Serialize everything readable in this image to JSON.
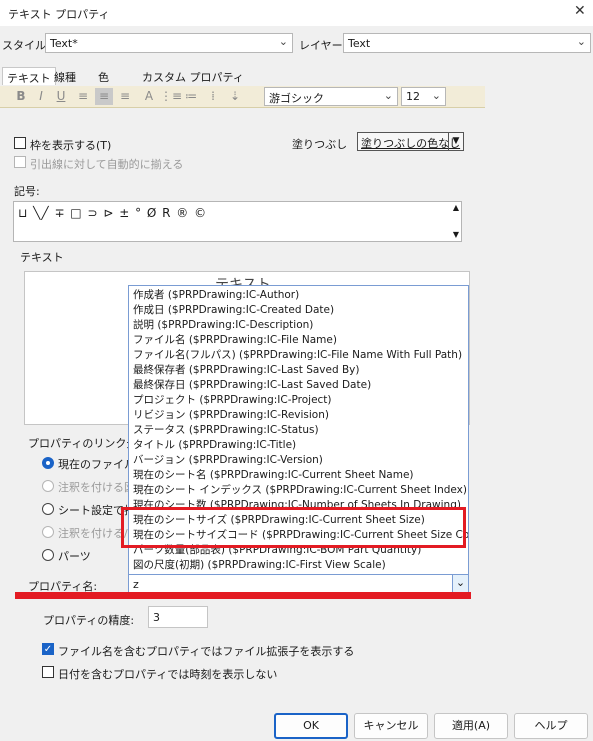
{
  "window": {
    "title": "テキスト プロパティ",
    "close_glyph": "✕"
  },
  "style": {
    "label": "スタイル:",
    "value": "Text*"
  },
  "layer": {
    "label": "レイヤー:",
    "value": "Text"
  },
  "tabs": [
    "テキスト",
    "線種",
    "色",
    "カスタム プロパティ"
  ],
  "toolbar": {
    "buttons": [
      {
        "glyph": "B",
        "icon": "bold-icon"
      },
      {
        "glyph": "I",
        "icon": "italic-icon"
      },
      {
        "glyph": "U",
        "icon": "underline-icon"
      },
      {
        "glyph": "≡",
        "icon": "align-left-icon"
      },
      {
        "glyph": "≡",
        "icon": "align-center-icon"
      },
      {
        "glyph": "≡",
        "icon": "align-right-icon"
      },
      {
        "glyph": "A",
        "icon": "stack-text-icon"
      },
      {
        "glyph": "⋮≡",
        "icon": "bullet-list-icon"
      },
      {
        "glyph": "≔",
        "icon": "numbered-list-icon"
      },
      {
        "glyph": "⁞",
        "icon": "list-icon"
      },
      {
        "glyph": "⇣",
        "icon": "insert-field-icon"
      }
    ],
    "font": "游ゴシック",
    "size": "12"
  },
  "frame": {
    "label": "枠を表示する(T)",
    "checked": false
  },
  "leader": {
    "label": "引出線に対して自動的に揃える",
    "checked": false,
    "disabled": true
  },
  "fill": {
    "label": "塗りつぶし",
    "value": "塗りつぶしの色なし"
  },
  "symbols": {
    "label": "記号:",
    "chars": "⊔ ╲╱ ∓ □ ⊃ ⊳ ± ° Ø R ® ©"
  },
  "text_group": {
    "label": "テキスト",
    "editor_text": "テキスト"
  },
  "link": {
    "label": "プロパティのリンク元を指",
    "options": [
      {
        "label": "現在のファイル",
        "selected": true,
        "disabled": false
      },
      {
        "label": "注釈を付ける図",
        "selected": false,
        "disabled": true
      },
      {
        "label": "シート設定で指",
        "selected": false,
        "disabled": false
      },
      {
        "label": "注釈を付ける/",
        "selected": false,
        "disabled": true
      },
      {
        "label": "パーツ",
        "selected": false,
        "disabled": false
      }
    ]
  },
  "property_name": {
    "label": "プロパティ名:",
    "value": "z"
  },
  "precision": {
    "label": "プロパティの精度:",
    "value": "3"
  },
  "show_ext": {
    "label": "ファイル名を含むプロパティではファイル拡張子を表示する",
    "checked": true
  },
  "hide_time": {
    "label": "日付を含むプロパティでは時刻を表示しない",
    "checked": false
  },
  "buttons": {
    "ok": "OK",
    "cancel": "キャンセル",
    "apply": "適用(A)",
    "help": "ヘルプ"
  },
  "dropdown": {
    "items": [
      "作成者  ($PRPDrawing:IC-Author)",
      "作成日  ($PRPDrawing:IC-Created Date)",
      "説明  ($PRPDrawing:IC-Description)",
      "ファイル名  ($PRPDrawing:IC-File Name)",
      "ファイル名(フルパス)  ($PRPDrawing:IC-File Name With Full Path)",
      "最終保存者  ($PRPDrawing:IC-Last Saved By)",
      "最終保存日  ($PRPDrawing:IC-Last Saved Date)",
      "プロジェクト  ($PRPDrawing:IC-Project)",
      "リビジョン  ($PRPDrawing:IC-Revision)",
      "ステータス  ($PRPDrawing:IC-Status)",
      "タイトル  ($PRPDrawing:IC-Title)",
      "バージョン  ($PRPDrawing:IC-Version)",
      "現在のシート名  ($PRPDrawing:IC-Current Sheet Name)",
      "現在のシート インデックス  ($PRPDrawing:IC-Current Sheet Index)",
      "現在のシート数  ($PRPDrawing:IC-Number of Sheets In Drawing)",
      "現在のシートサイズ  ($PRPDrawing:IC-Current Sheet Size)",
      "現在のシートサイズコード  ($PRPDrawing:IC-Current Sheet Size Code)",
      "パーツ数量(部品表)  ($PRPDrawing:IC-BOM Part Quantity)",
      "図の尺度(初期)  ($PRPDrawing:IC-First View Scale)"
    ]
  },
  "colors": {
    "accent": "#1a63c7",
    "highlight": "#e31b23",
    "toolbar_bg": "#f2ecd8"
  }
}
